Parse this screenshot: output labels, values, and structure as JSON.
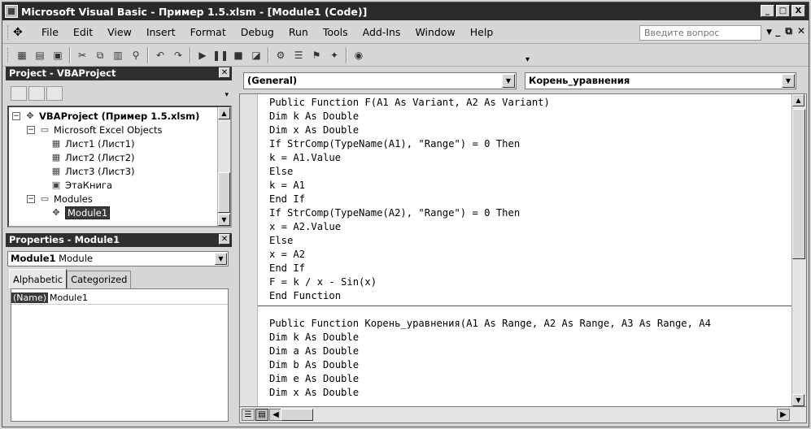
{
  "window": {
    "title": "Microsoft Visual Basic - Пример 1.5.xlsm - [Module1 (Code)]",
    "controls": [
      "_",
      "□",
      "X"
    ]
  },
  "menu": {
    "items": [
      "File",
      "Edit",
      "View",
      "Insert",
      "Format",
      "Debug",
      "Run",
      "Tools",
      "Add-Ins",
      "Window",
      "Help"
    ],
    "ask_placeholder": "Введите вопрос",
    "mdi_controls": [
      "-",
      "_",
      "⧉",
      "✕"
    ]
  },
  "project": {
    "title": "Project - VBAProject",
    "tree": {
      "root": "VBAProject (Пример 1.5.xlsm)",
      "excel_objects": "Microsoft Excel Objects",
      "sheets": [
        "Лист1 (Лист1)",
        "Лист2 (Лист2)",
        "Лист3 (Лист3)"
      ],
      "workbook": "ЭтаКнига",
      "modules_folder": "Modules",
      "module": "Module1"
    }
  },
  "properties": {
    "title": "Properties - Module1",
    "object_name": "Module1",
    "object_type": "Module",
    "tabs": [
      "Alphabetic",
      "Categorized"
    ],
    "rows": [
      {
        "name": "(Name)",
        "value": "Module1"
      }
    ]
  },
  "code": {
    "object_combo": "(General)",
    "proc_combo": "Корень_уравнения",
    "lines": [
      "Public Function F(A1 As Variant, A2 As Variant)",
      "Dim k As Double",
      "Dim x As Double",
      "If StrComp(TypeName(A1), \"Range\") = 0 Then",
      "k = A1.Value",
      "Else",
      "k = A1",
      "End If",
      "If StrComp(TypeName(A2), \"Range\") = 0 Then",
      "x = A2.Value",
      "Else",
      "x = A2",
      "End If",
      "F = k / x - Sin(x)",
      "End Function",
      "",
      "Public Function Корень_уравнения(A1 As Range, A2 As Range, A3 As Range, A4",
      "Dim k As Double",
      "Dim a As Double",
      "Dim b As Double",
      "Dim e As Double",
      "Dim x As Double"
    ]
  }
}
